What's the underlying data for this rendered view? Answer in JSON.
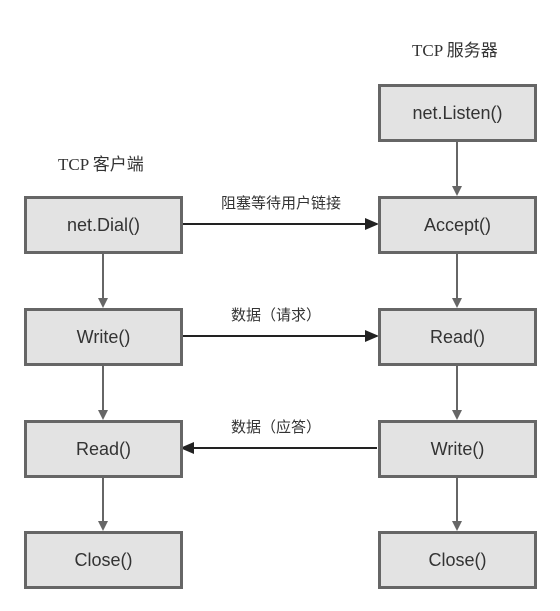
{
  "client": {
    "heading": "TCP 客户端",
    "boxes": [
      "net.Dial()",
      "Write()",
      "Read()",
      "Close()"
    ]
  },
  "server": {
    "heading": "TCP 服务器",
    "boxes": [
      "net.Listen()",
      "Accept()",
      "Read()",
      "Write()",
      "Close()"
    ]
  },
  "messages": [
    {
      "label": "阻塞等待用户链接",
      "direction": "to-server"
    },
    {
      "label": "数据（请求）",
      "direction": "to-server"
    },
    {
      "label": "数据（应答）",
      "direction": "to-client"
    }
  ],
  "colors": {
    "box_fill": "#e3e3e3",
    "box_border": "#666666",
    "flow_arrow": "#666666",
    "message_arrow": "#222222",
    "text": "#333333"
  }
}
